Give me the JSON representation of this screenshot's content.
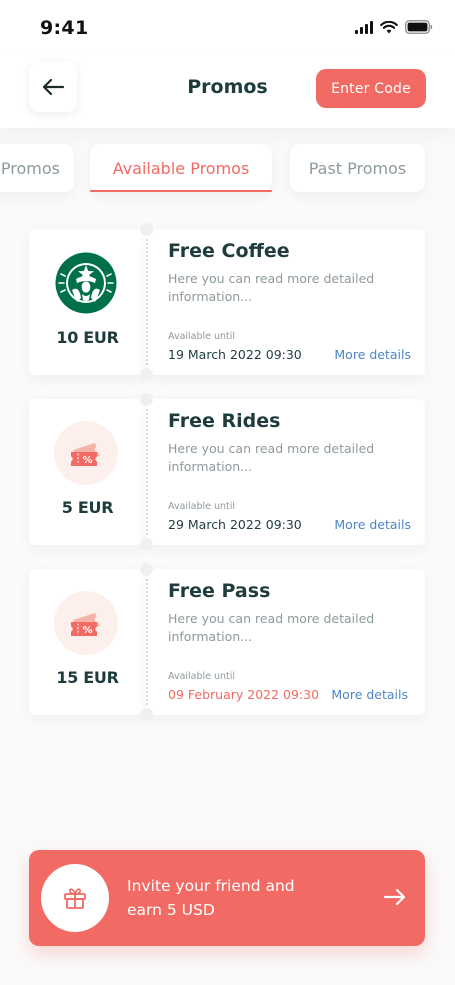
{
  "status_bar": {
    "time": "9:41",
    "icons": [
      "cellular-signal-icon",
      "wifi-icon",
      "battery-icon"
    ]
  },
  "header": {
    "title": "Promos",
    "back_icon": "arrow-left-icon",
    "enter_code_label": "Enter Code"
  },
  "tabs": [
    {
      "label": "Promos",
      "active": false
    },
    {
      "label": "Available Promos",
      "active": true
    },
    {
      "label": "Past Promos",
      "active": false
    }
  ],
  "promos": [
    {
      "logo": "starbucks-logo",
      "amount": "10 EUR",
      "title": "Free Coffee",
      "description": "Here you can read more detailed information...",
      "available_label": "Available until",
      "available_date": "19 March 2022 09:30",
      "expired": false,
      "more_label": "More details"
    },
    {
      "logo": "discount-ticket-icon",
      "amount": "5 EUR",
      "title": "Free Rides",
      "description": "Here you can read more detailed information...",
      "available_label": "Available until",
      "available_date": "29 March 2022 09:30",
      "expired": false,
      "more_label": "More details"
    },
    {
      "logo": "discount-ticket-icon",
      "amount": "15 EUR",
      "title": "Free Pass",
      "description": "Here you can read more detailed information...",
      "available_label": "Available until",
      "available_date": "09 February 2022 09:30",
      "expired": true,
      "more_label": "More details"
    }
  ],
  "invite": {
    "line1": "Invite your friend and",
    "line2": "earn 5 USD",
    "icon": "gift-icon",
    "arrow_icon": "arrow-right-icon"
  },
  "colors": {
    "accent": "#f16a63",
    "text_dark": "#1f3c3d",
    "text_muted": "#8e9a9c",
    "link": "#4d86c9",
    "ticket_bg": "#fdf0ec",
    "starbucks_green": "#00704a"
  }
}
